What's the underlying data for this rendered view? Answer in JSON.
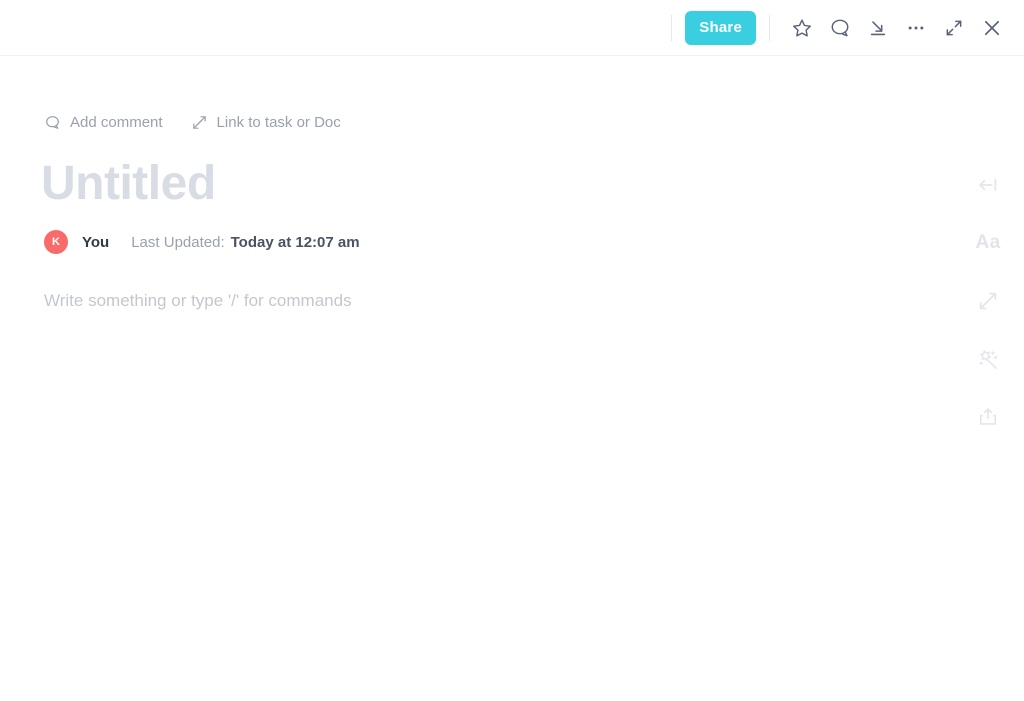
{
  "header": {
    "share_label": "Share",
    "accent_color": "#3acfe0",
    "icons": [
      {
        "name": "star-icon",
        "title": "Favorite"
      },
      {
        "name": "comment-icon",
        "title": "Comments"
      },
      {
        "name": "download-icon",
        "title": "Download"
      },
      {
        "name": "more-icon",
        "title": "More"
      },
      {
        "name": "expand-icon",
        "title": "Expand"
      },
      {
        "name": "close-icon",
        "title": "Close"
      }
    ]
  },
  "doc": {
    "add_comment_label": "Add comment",
    "link_label": "Link to task or Doc",
    "title": "Untitled",
    "author": {
      "avatar_initial": "K",
      "avatar_color": "#f96b6b",
      "name": "You"
    },
    "updated_label": "Last Updated:",
    "updated_value": "Today at 12:07 am",
    "body_placeholder": "Write something or type '/' for commands"
  },
  "rail": {
    "items": [
      {
        "name": "collapse-panel-icon",
        "label": ""
      },
      {
        "name": "font-icon",
        "label": "Aa"
      },
      {
        "name": "relationship-icon",
        "label": ""
      },
      {
        "name": "magic-wand-icon",
        "label": ""
      },
      {
        "name": "upload-icon",
        "label": ""
      }
    ]
  }
}
